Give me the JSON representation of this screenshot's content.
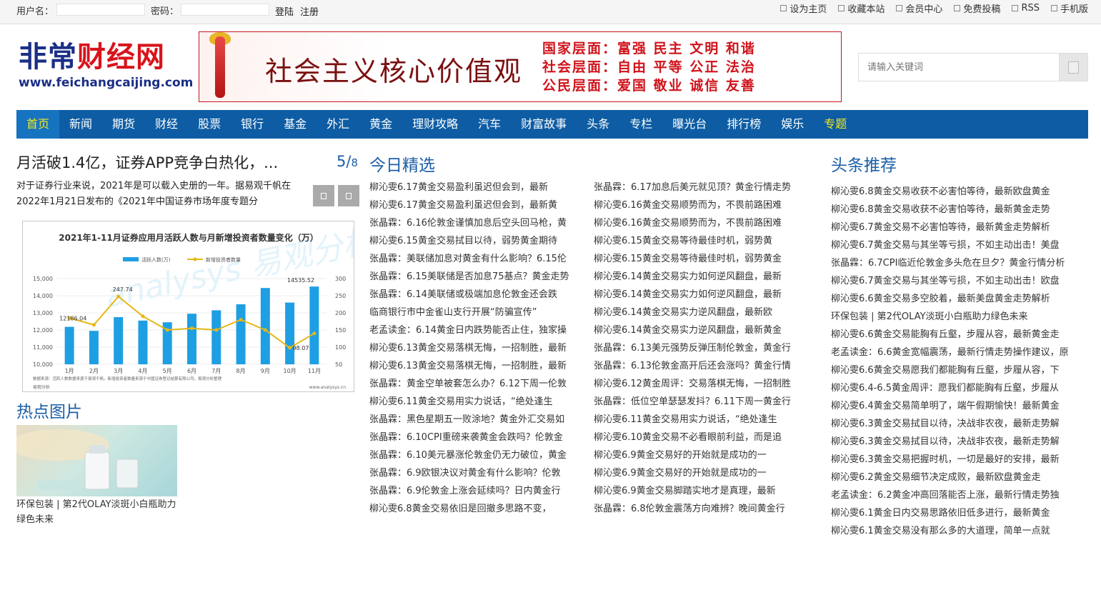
{
  "topbar": {
    "username_label": "用户名：",
    "password_label": "密码：",
    "login": "登陆",
    "register": "注册",
    "links": [
      "设为主页",
      "收藏本站",
      "会员中心",
      "免费投稿",
      "RSS",
      "手机版"
    ]
  },
  "logo": {
    "part1": "非常",
    "part2": "财经网",
    "url": "www.feichangcaijing.com"
  },
  "banner": {
    "slogan": "社会主义核心价值观",
    "lines": [
      "国家层面：富强 民主 文明 和谐",
      "社会层面：自由 平等 公正 法治",
      "公民层面：爱国 敬业 诚信 友善"
    ]
  },
  "search": {
    "placeholder": "请输入关键词"
  },
  "nav": [
    "首页",
    "新闻",
    "期货",
    "财经",
    "股票",
    "银行",
    "基金",
    "外汇",
    "黄金",
    "理财攻略",
    "汽车",
    "财富故事",
    "头条",
    "专栏",
    "曝光台",
    "排行榜",
    "娱乐",
    "专题"
  ],
  "feature": {
    "title": "月活破1.4亿，证券APP竞争白热化，...",
    "page": "5/",
    "total": "8",
    "summary": "对于证券行业来说，2021年是可以载入史册的一年。据易观千帆在2022年1月21日发布的《2021年中国证券市场年度专题分"
  },
  "chart_data": {
    "type": "bar",
    "title": "2021年1-11月证券应用月活跃人数与月新增投资者数量变化（万）",
    "categories": [
      "1月",
      "2月",
      "3月",
      "4月",
      "5月",
      "6月",
      "7月",
      "8月",
      "9月",
      "10月",
      "11月"
    ],
    "series": [
      {
        "name": "活跃人数(万)",
        "type": "bar",
        "axis": "left",
        "values": [
          12186.04,
          11950,
          12750,
          12550,
          12450,
          12950,
          13150,
          13500,
          14450,
          13600,
          14535.52
        ]
      },
      {
        "name": "新增投资者数量",
        "type": "line",
        "axis": "right",
        "values": [
          185,
          165,
          247.74,
          190,
          150,
          155,
          150,
          180,
          150,
          98.07,
          140
        ]
      }
    ],
    "ylim_left": [
      10000,
      15000
    ],
    "ylim_right": [
      50,
      300
    ],
    "yticks_left": [
      "15,000",
      "14,000",
      "13,000",
      "12,000",
      "11,000",
      "10,000"
    ],
    "yticks_right": [
      "300",
      "250",
      "200",
      "150",
      "100",
      "50"
    ],
    "labels": [
      "12186.04",
      "247.74",
      "14535.52",
      "98.07"
    ],
    "source_note": "数据来源：活跃人数数据来源于易观千帆。新增投资者数量来源于中国证券登记结算有限公司。易观分析整理",
    "brand_left": "易观分析",
    "brand_right": "www.analysys.cn",
    "watermark": "analysys 易观分析",
    "colors": {
      "bar": "#1f9fe3",
      "line": "#e6b714"
    }
  },
  "hot": {
    "title": "热点图片",
    "caption": "环保包装 | 第2代OLAY淡斑小白瓶助力绿色未来"
  },
  "today": {
    "title": "今日精选",
    "col1": [
      "柳沁雯6.17黄金交易盈利虽迟但会到，最新",
      "柳沁雯6.17黄金交易盈利虽迟但会到，最新黄",
      "张晶霖：6.16伦敦金谨慎加息后空头回马枪，黄",
      "柳沁雯6.15黄金交易拭目以待，弱势黄金期待",
      "张晶霖：美联储加息对黄金有什么影响？6.15伦",
      "张晶霖：6.15美联储是否加息75基点？黄金走势",
      "张晶霖：6.14美联储或极端加息伦敦金还会跌",
      "临商银行市中金雀山支行开展“防骗宣传”",
      "老孟读金：6.14黄金日内跌势能否止住，独家操",
      "柳沁雯6.13黄金交易落棋无悔，一招制胜，最新",
      "柳沁雯6.13黄金交易落棋无悔，一招制胜，最新",
      "张晶霖：黄金空单被套怎么办？6.12下周一伦敦",
      "柳沁雯6.11黄金交易用实力说话，“绝处逢生",
      "张晶霖：黑色星期五一败涂地？黄金外汇交易如",
      "张晶霖：6.10CPI重磅来袭黄金会跌吗？伦敦金",
      "张晶霖：6.10美元暴涨伦敦金仍无力破位，黄金",
      "张晶霖：6.9欧银决议对黄金有什么影响？伦敦",
      "张晶霖：6.9伦敦金上涨会延续吗？日内黄金行",
      "柳沁雯6.8黄金交易依旧是回撤多思路不变，"
    ],
    "col2": [
      "张晶霖：6.17加息后美元就见顶？黄金行情走势",
      "柳沁雯6.16黄金交易顺势而为，不畏前路困难",
      "柳沁雯6.16黄金交易顺势而为，不畏前路困难",
      "柳沁雯6.15黄金交易等待最佳时机，弱势黄",
      "柳沁雯6.15黄金交易等待最佳时机，弱势黄金",
      "柳沁雯6.14黄金交易实力如何逆风翻盘，最新",
      "柳沁雯6.14黄金交易实力如何逆风翻盘，最新",
      "柳沁雯6.14黄金交易实力逆风翻盘，最新欧",
      "柳沁雯6.14黄金交易实力逆风翻盘，最新黄金",
      "张晶霖：6.13美元强势反弹压制伦敦金，黄金行",
      "张晶霖：6.13伦敦金高开后还会涨吗？黄金行情",
      "柳沁雯6.12黄金周评：交易落棋无悔，一招制胜",
      "张晶霖：低位空单瑟瑟发抖？6.11下周一黄金行",
      "柳沁雯6.11黄金交易用实力说话，“绝处逢生",
      "柳沁雯6.10黄金交易不必看眼前利益，而是追",
      "柳沁雯6.9黄金交易好的开始就是成功的一",
      "柳沁雯6.9黄金交易好的开始就是成功的一",
      "柳沁雯6.9黄金交易脚踏实地才是真理，最新",
      "张晶霖：6.8伦敦金震荡方向难辨？晚间黄金行"
    ]
  },
  "headlines": {
    "title": "头条推荐",
    "items": [
      "柳沁雯6.8黄金交易收获不必害怕等待，最新欧盘黄金",
      "柳沁雯6.8黄金交易收获不必害怕等待，最新黄金走势",
      "柳沁雯6.7黄金交易不必害怕等待，最新黄金走势解析",
      "柳沁雯6.7黄金交易与其坐等亏损，不如主动出击！美盘",
      "张晶霖：6.7CPI临近伦敦金多头危在旦夕？黄金行情分析",
      "柳沁雯6.7黄金交易与其坐等亏损，不如主动出击！欧盘",
      "柳沁雯6.6黄金交易多空胶着，最新美盘黄金走势解析",
      "环保包装 | 第2代OLAY淡斑小白瓶助力绿色未来",
      "柳沁雯6.6黄金交易能胸有丘壑，步履从容，最新黄金走",
      "老孟读金：6.6黄金宽幅震荡，最新行情走势操作建议，原",
      "柳沁雯6.6黄金交易愿我们都能胸有丘壑，步履从容，下",
      "柳沁雯6.4-6.5黄金周评：愿我们都能胸有丘壑，步履从",
      "柳沁雯6.4黄金交易简单明了，端午假期愉快！最新黄金",
      "柳沁雯6.3黄金交易拭目以待，决战非农夜，最新走势解",
      "柳沁雯6.3黄金交易拭目以待，决战非农夜，最新走势解",
      "柳沁雯6.3黄金交易把握时机，一切是最好的安排，最新",
      "柳沁雯6.2黄金交易细节决定成败，最新欧盘黄金走",
      "老孟读金：6.2黄金冲高回落能否上涨，最新行情走势独",
      "柳沁雯6.1黄金日内交易思路依旧低多进行，最新黄金",
      "柳沁雯6.1黄金交易没有那么多的大道理，简单一点就"
    ]
  }
}
